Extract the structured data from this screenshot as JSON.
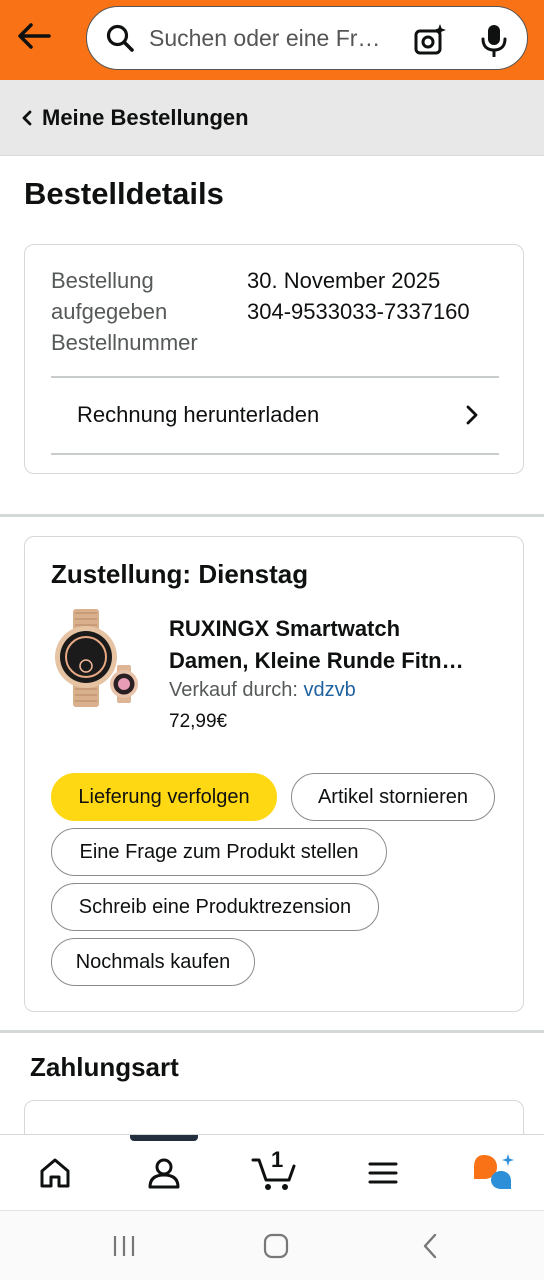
{
  "header": {
    "search_placeholder": "Suchen oder eine Fr…",
    "back_icon": "arrow-left-icon",
    "search_icon": "search-icon",
    "camera_icon": "camera-sparkle-icon",
    "mic_icon": "microphone-icon",
    "accent": "#f97316"
  },
  "breadcrumb": {
    "label": "Meine Bestellungen"
  },
  "page": {
    "title": "Bestelldetails"
  },
  "order": {
    "keys": "Bestellung aufgegeben Bestellnummer",
    "date": "30. November 2025",
    "number": "304-9533033-7337160",
    "invoice_label": "Rechnung herunterladen"
  },
  "shipment": {
    "delivery": "Zustellung: Dienstag",
    "product_line1": "RUXINGX Smartwatch",
    "product_line2": "Damen, Kleine Runde Fitn…",
    "seller_prefix": "Verkauf durch:",
    "seller_name": "vdzvb",
    "price": "72,99€",
    "actions": {
      "track": "Lieferung verfolgen",
      "cancel": "Artikel stornieren",
      "question": "Eine Frage zum Produkt stellen",
      "review": "Schreib eine Produktrezension",
      "rebuy": "Nochmals kaufen"
    },
    "primary_color": "#ffd814"
  },
  "payment": {
    "title": "Zahlungsart"
  },
  "bottom_nav": {
    "cart_count": "1",
    "icons": [
      "home-icon",
      "account-icon",
      "cart-icon",
      "menu-icon",
      "rufus-assistant-icon"
    ]
  },
  "system_nav": {
    "icons": [
      "recents-icon",
      "home-button-icon",
      "back-nav-icon"
    ]
  }
}
